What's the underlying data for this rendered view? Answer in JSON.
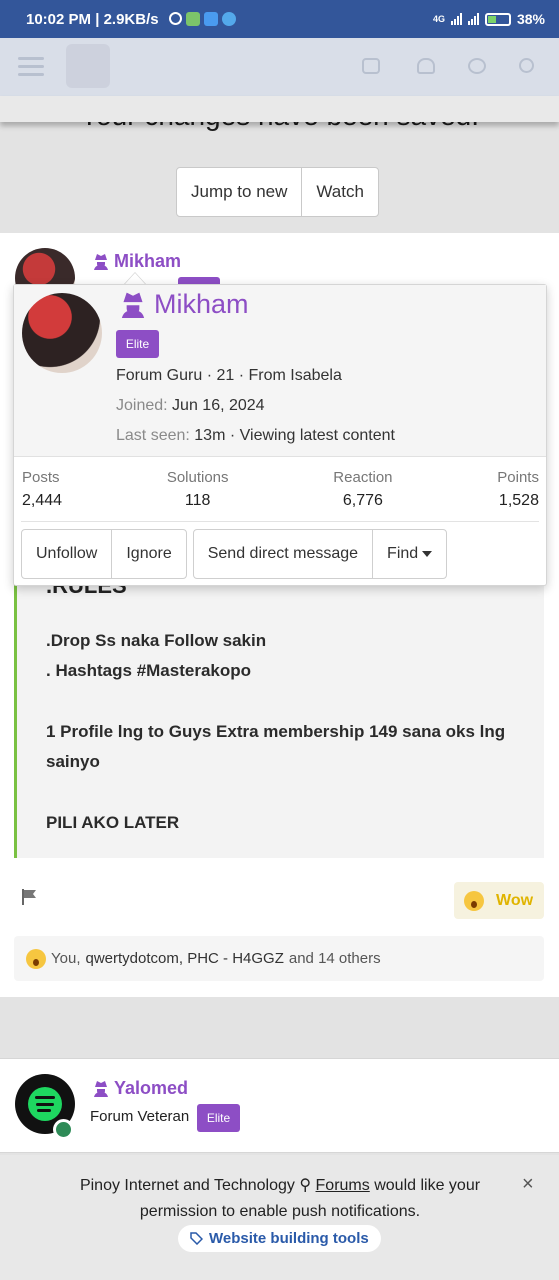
{
  "status_bar": {
    "time_speed": "10:02 PM | 2.9KB/s",
    "network": "4G",
    "battery": "38%"
  },
  "toast": {
    "message": "Your changes have been saved."
  },
  "thread_actions": {
    "jump_label": "Jump to new",
    "watch_label": "Watch"
  },
  "post": {
    "username": "Mikham",
    "rules_heading": ".RULES",
    "lines": [
      ".Drop Ss naka Follow sakin",
      ". Hashtags #Masterakopo",
      "1 Profile lng to Guys Extra membership 149 sana oks lng sainyo",
      "PILI AKO LATER"
    ],
    "reaction": {
      "label": "Wow"
    },
    "reactions_summary": {
      "prefix": "You,",
      "names": "qwertydotcom, PHC - H4GGZ",
      "suffix": "and 14 others"
    }
  },
  "member_card": {
    "name": "Mikham",
    "badge": "Elite",
    "info": "Forum Guru · 21 · From Isabela",
    "joined_label": "Joined:",
    "joined_value": "Jun 16, 2024",
    "last_seen_label": "Last seen:",
    "last_seen_value": "13m · Viewing latest content",
    "stats": [
      {
        "label": "Posts",
        "value": "2,444"
      },
      {
        "label": "Solutions",
        "value": "118"
      },
      {
        "label": "Reaction",
        "value": "6,776"
      },
      {
        "label": "Points",
        "value": "1,528"
      }
    ],
    "actions": {
      "unfollow": "Unfollow",
      "ignore": "Ignore",
      "message": "Send direct message",
      "find": "Find"
    }
  },
  "next_post": {
    "username": "Yalomed",
    "title": "Forum Veteran",
    "badge": "Elite"
  },
  "push_prompt": {
    "text_before": "Pinoy Internet and Technology",
    "link_text": "Forums",
    "text_after": "would like your permission to enable push notifications.",
    "tag_label": "Website building tools",
    "close_symbol": "×"
  },
  "colors": {
    "status_bar": "#33569a",
    "username": "#8d4ec5",
    "quote_border": "#7ac142",
    "link": "#2a5aa9"
  }
}
